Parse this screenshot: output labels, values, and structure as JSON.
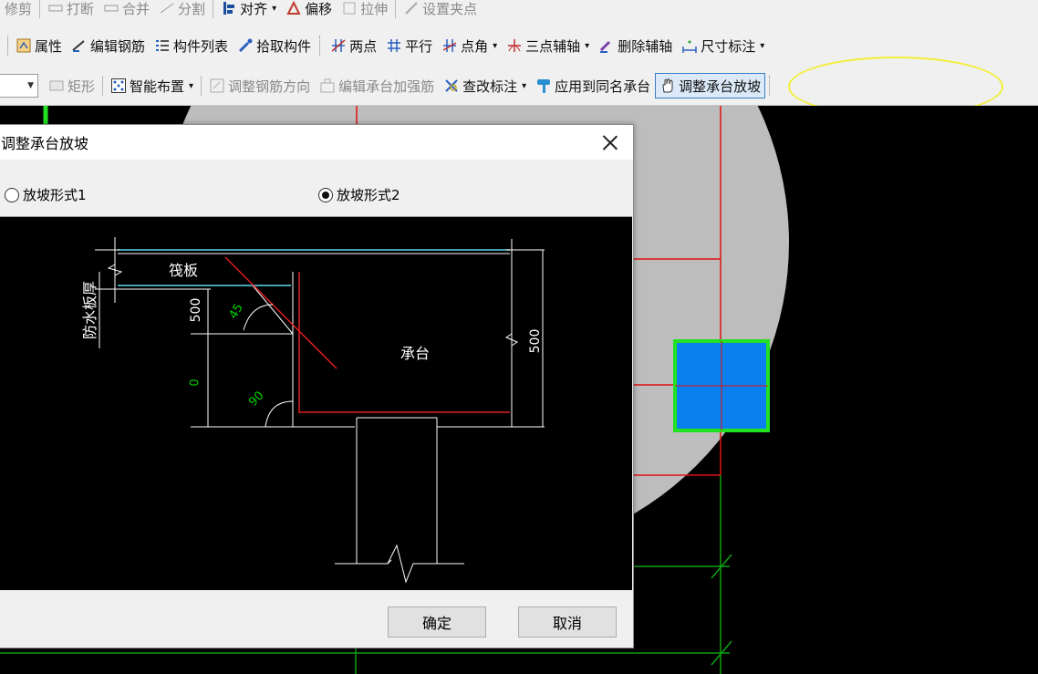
{
  "toolbar": {
    "row1": [
      "修剪",
      "打断",
      "合并",
      "分割",
      "对齐",
      "偏移",
      "拉伸",
      "设置夹点"
    ],
    "row2": [
      "属性",
      "编辑钢筋",
      "构件列表",
      "拾取构件",
      "两点",
      "平行",
      "点角",
      "三点辅轴",
      "删除辅轴",
      "尺寸标注"
    ],
    "row3": [
      "矩形",
      "智能布置",
      "调整钢筋方向",
      "编辑承台加强筋",
      "查改标注",
      "应用到同名承台",
      "调整承台放坡"
    ]
  },
  "dialog": {
    "title": "调整承台放坡",
    "radio1": "放坡形式1",
    "radio2": "放坡形式2",
    "selected": "放坡形式2",
    "ok": "确定",
    "cancel": "取消",
    "diagram": {
      "raft": "筏板",
      "cap": "承台",
      "waterproof": "防水板厚",
      "dim_top": "500",
      "dim_bottom": "0",
      "dim_right": "500",
      "angle1": "45",
      "angle2": "90"
    }
  },
  "colors": {
    "column_fill": "#0a7ff0",
    "column_border": "#22e022",
    "highlight": "#f3ee3a",
    "gridline": "#e01010",
    "axis": "#10a010"
  }
}
